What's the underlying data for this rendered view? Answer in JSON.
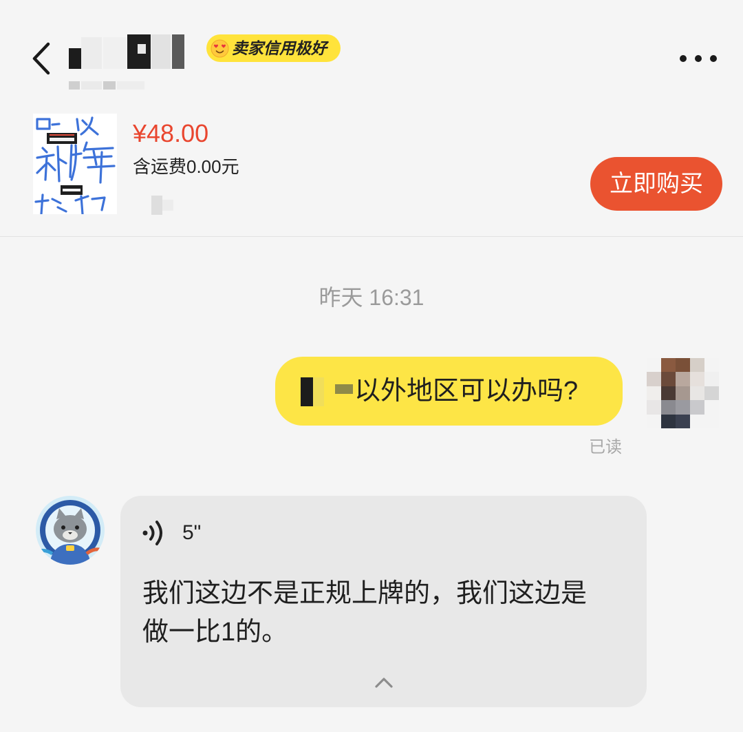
{
  "header": {
    "back_icon": "chevron-left-icon",
    "seller_badge": {
      "icon": "heart-eyes-emoji-icon",
      "label": "卖家信用极好"
    },
    "more_icon": "more-dots-icon"
  },
  "product": {
    "thumbnail_icon": "product-thumbnail",
    "price": "¥48.00",
    "shipping": "含运费0.00元",
    "buy_button": "立即购买"
  },
  "chat": {
    "timestamp": "昨天 16:31",
    "outgoing_message": {
      "text": "以外地区可以办吗?",
      "status": "已读"
    },
    "incoming_message": {
      "voice_icon": "voice-wave-icon",
      "duration": "5\"",
      "transcript_lines": [
        "我们这边不是正规上牌的，我们这边是",
        "做一比1的。"
      ],
      "collapse_icon": "chevron-up-icon"
    }
  },
  "colors": {
    "background": "#f5f5f5",
    "price": "#e9462f",
    "buy_button": "#ea5330",
    "badge": "#ffe33b",
    "outgoing_bubble": "#fde546",
    "incoming_bubble": "#e8e8e8",
    "muted_text": "#9a9a9a"
  }
}
